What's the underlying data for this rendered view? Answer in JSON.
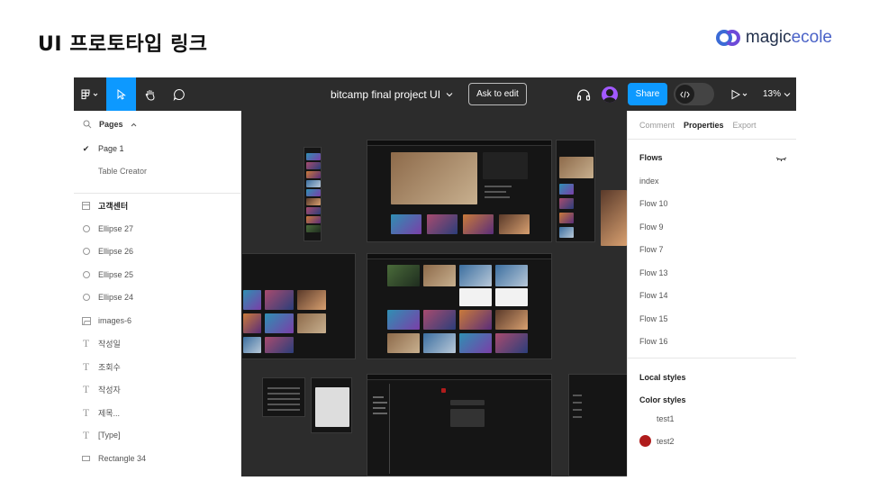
{
  "slide": {
    "title": "UI 프로토타입 링크",
    "brand_part1": "magic",
    "brand_part2": "ecole"
  },
  "toolbar": {
    "file_title": "bitcamp final project UI",
    "ask_to_edit": "Ask to edit",
    "share": "Share",
    "zoom": "13%"
  },
  "left_panel": {
    "pages_header": "Pages",
    "pages": [
      {
        "label": "Page 1",
        "selected": true
      },
      {
        "label": "Table Creator",
        "selected": false
      }
    ],
    "layers": [
      {
        "label": "고객센터",
        "icon": "frame-icon"
      },
      {
        "label": "Ellipse 27",
        "icon": "ellipse-icon"
      },
      {
        "label": "Ellipse 26",
        "icon": "ellipse-icon"
      },
      {
        "label": "Ellipse 25",
        "icon": "ellipse-icon"
      },
      {
        "label": "Ellipse 24",
        "icon": "ellipse-icon"
      },
      {
        "label": "images-6",
        "icon": "image-icon"
      },
      {
        "label": "작성일",
        "icon": "text-icon"
      },
      {
        "label": "조회수",
        "icon": "text-icon"
      },
      {
        "label": "작성자",
        "icon": "text-icon"
      },
      {
        "label": "제목...",
        "icon": "text-icon"
      },
      {
        "label": "[Type]",
        "icon": "text-icon"
      },
      {
        "label": "Rectangle 34",
        "icon": "rectangle-icon"
      }
    ]
  },
  "right_panel": {
    "tabs": [
      "Comment",
      "Properties",
      "Export"
    ],
    "active_tab": "Properties",
    "flows_heading": "Flows",
    "flows": [
      "index",
      "Flow 10",
      "Flow 9",
      "Flow 7",
      "Flow 13",
      "Flow 14",
      "Flow 15",
      "Flow 16"
    ],
    "local_styles_heading": "Local styles",
    "color_styles_heading": "Color styles",
    "color_styles": [
      {
        "name": "test1",
        "color": ""
      },
      {
        "name": "test2",
        "color": "#b01c1c"
      }
    ]
  },
  "colors": {
    "accent": "#0d99ff",
    "toolbar_bg": "#2c2c2c",
    "canvas_bg": "#2c2c2c"
  }
}
